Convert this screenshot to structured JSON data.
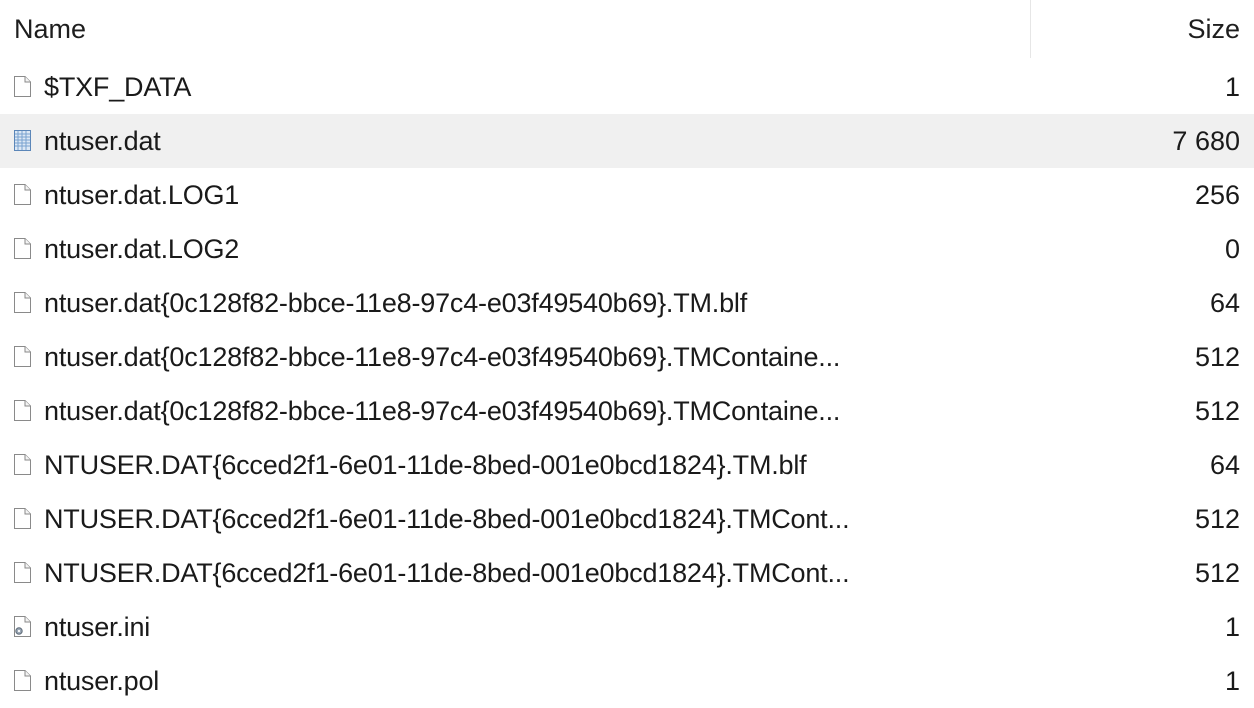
{
  "columns": {
    "name": "Name",
    "size": "Size"
  },
  "files": [
    {
      "name": "$TXF_DATA",
      "size": "1",
      "icon": "file-icon",
      "selected": false
    },
    {
      "name": "ntuser.dat",
      "size": "7 680",
      "icon": "registry-hive-icon",
      "selected": true
    },
    {
      "name": "ntuser.dat.LOG1",
      "size": "256",
      "icon": "file-icon",
      "selected": false
    },
    {
      "name": "ntuser.dat.LOG2",
      "size": "0",
      "icon": "file-icon",
      "selected": false
    },
    {
      "name": "ntuser.dat{0c128f82-bbce-11e8-97c4-e03f49540b69}.TM.blf",
      "size": "64",
      "icon": "file-icon",
      "selected": false
    },
    {
      "name": "ntuser.dat{0c128f82-bbce-11e8-97c4-e03f49540b69}.TMContaine...",
      "size": "512",
      "icon": "file-icon",
      "selected": false
    },
    {
      "name": "ntuser.dat{0c128f82-bbce-11e8-97c4-e03f49540b69}.TMContaine...",
      "size": "512",
      "icon": "file-icon",
      "selected": false
    },
    {
      "name": "NTUSER.DAT{6cced2f1-6e01-11de-8bed-001e0bcd1824}.TM.blf",
      "size": "64",
      "icon": "file-icon",
      "selected": false
    },
    {
      "name": "NTUSER.DAT{6cced2f1-6e01-11de-8bed-001e0bcd1824}.TMCont...",
      "size": "512",
      "icon": "file-icon",
      "selected": false
    },
    {
      "name": "NTUSER.DAT{6cced2f1-6e01-11de-8bed-001e0bcd1824}.TMCont...",
      "size": "512",
      "icon": "file-icon",
      "selected": false
    },
    {
      "name": "ntuser.ini",
      "size": "1",
      "icon": "settings-file-icon",
      "selected": false
    },
    {
      "name": "ntuser.pol",
      "size": "1",
      "icon": "file-icon",
      "selected": false
    }
  ],
  "colors": {
    "selected_row": "#f0f0f0",
    "text": "#1a1a1a"
  }
}
